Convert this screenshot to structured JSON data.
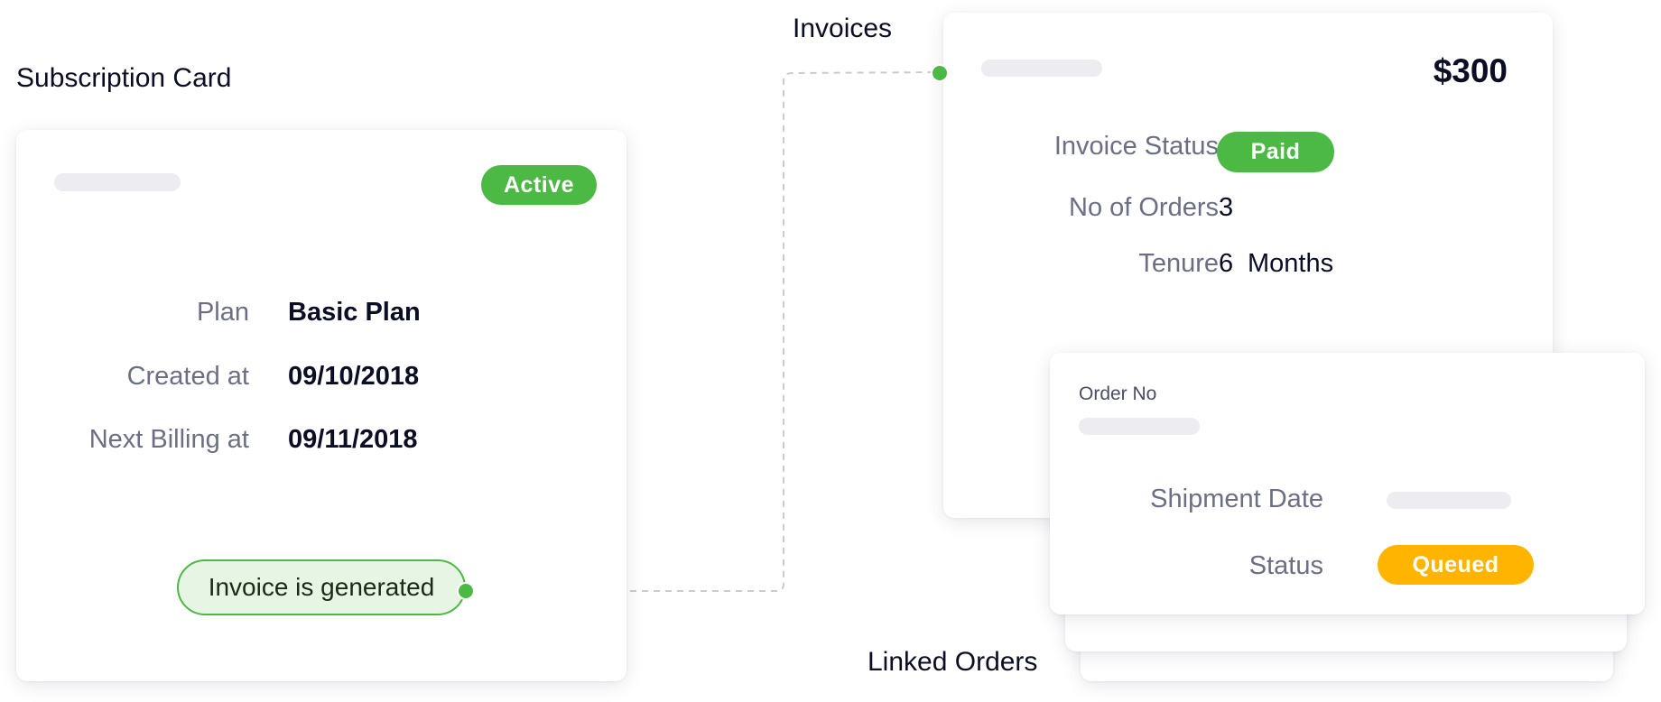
{
  "subscription": {
    "section_title": "Subscription Card",
    "status_badge": "Active",
    "rows": [
      {
        "label": "Plan",
        "value": "Basic Plan"
      },
      {
        "label": "Created at",
        "value": "09/10/2018"
      },
      {
        "label": "Next Billing at",
        "value": "09/11/2018"
      }
    ],
    "event_label": "Invoice is generated"
  },
  "invoice": {
    "section_title": "Invoices",
    "amount": "$300",
    "status_label": "Invoice Status",
    "status_value": "Paid",
    "orders_label": "No of Orders",
    "orders_value": "3",
    "tenure_label": "Tenure",
    "tenure_number": "6",
    "tenure_unit": "Months"
  },
  "orders": {
    "section_title": "Linked Orders",
    "order_no_label": "Order No",
    "shipment_label": "Shipment Date",
    "status_label": "Status",
    "status_value": "Queued"
  },
  "colors": {
    "green": "#4cb944",
    "green_light": "#e7f5e4",
    "amber": "#ffb500",
    "placeholder": "#ececf1",
    "connector": "#c9cbd3"
  }
}
